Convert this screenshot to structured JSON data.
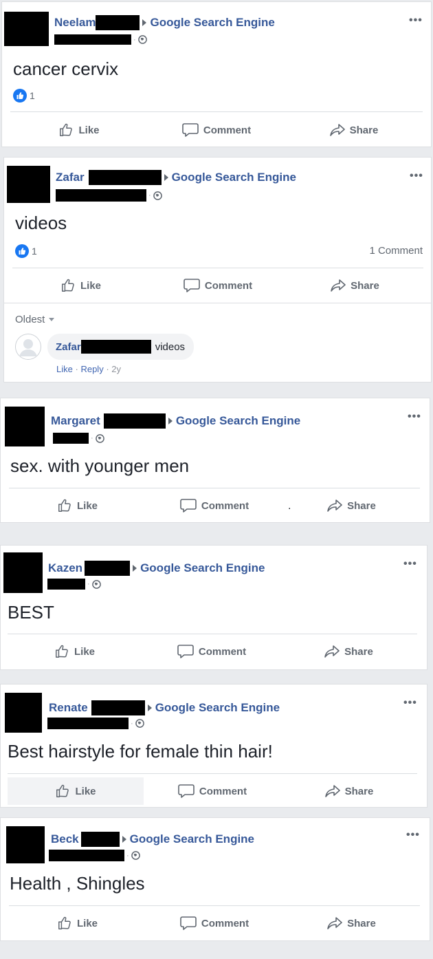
{
  "ui": {
    "like": "Like",
    "comment": "Comment",
    "share": "Share",
    "more": "•••",
    "dot": "·"
  },
  "posts": [
    {
      "author": "Neelam",
      "target": "Google Search Engine",
      "text": "cancer cervix",
      "likes": "1"
    },
    {
      "author": "Zafar",
      "target": "Google Search Engine",
      "text": "videos",
      "likes": "1",
      "comments_count": "1 Comment",
      "sort_label": "Oldest",
      "comment": {
        "author": "Zafar",
        "text": "videos",
        "like": "Like",
        "reply": "Reply",
        "age": "2y"
      }
    },
    {
      "author": "Margaret",
      "target": "Google Search Engine",
      "text": "sex. with younger men",
      "stray_mark": "."
    },
    {
      "author": "Kazen",
      "target": "Google Search Engine",
      "text": "BEST"
    },
    {
      "author": "Renate",
      "target": "Google Search Engine",
      "text": "Best hairstyle for female thin hair!"
    },
    {
      "author": "Beck",
      "target": "Google Search Engine",
      "text": "Health , Shingles"
    }
  ],
  "colors": {
    "link": "#365899",
    "secondary": "#606770",
    "like_blue": "#1877f2"
  },
  "icons": [
    "globe-icon",
    "thumbs-up-icon",
    "comment-icon",
    "share-icon",
    "more-options-icon",
    "like-reaction-icon",
    "default-avatar-icon"
  ]
}
